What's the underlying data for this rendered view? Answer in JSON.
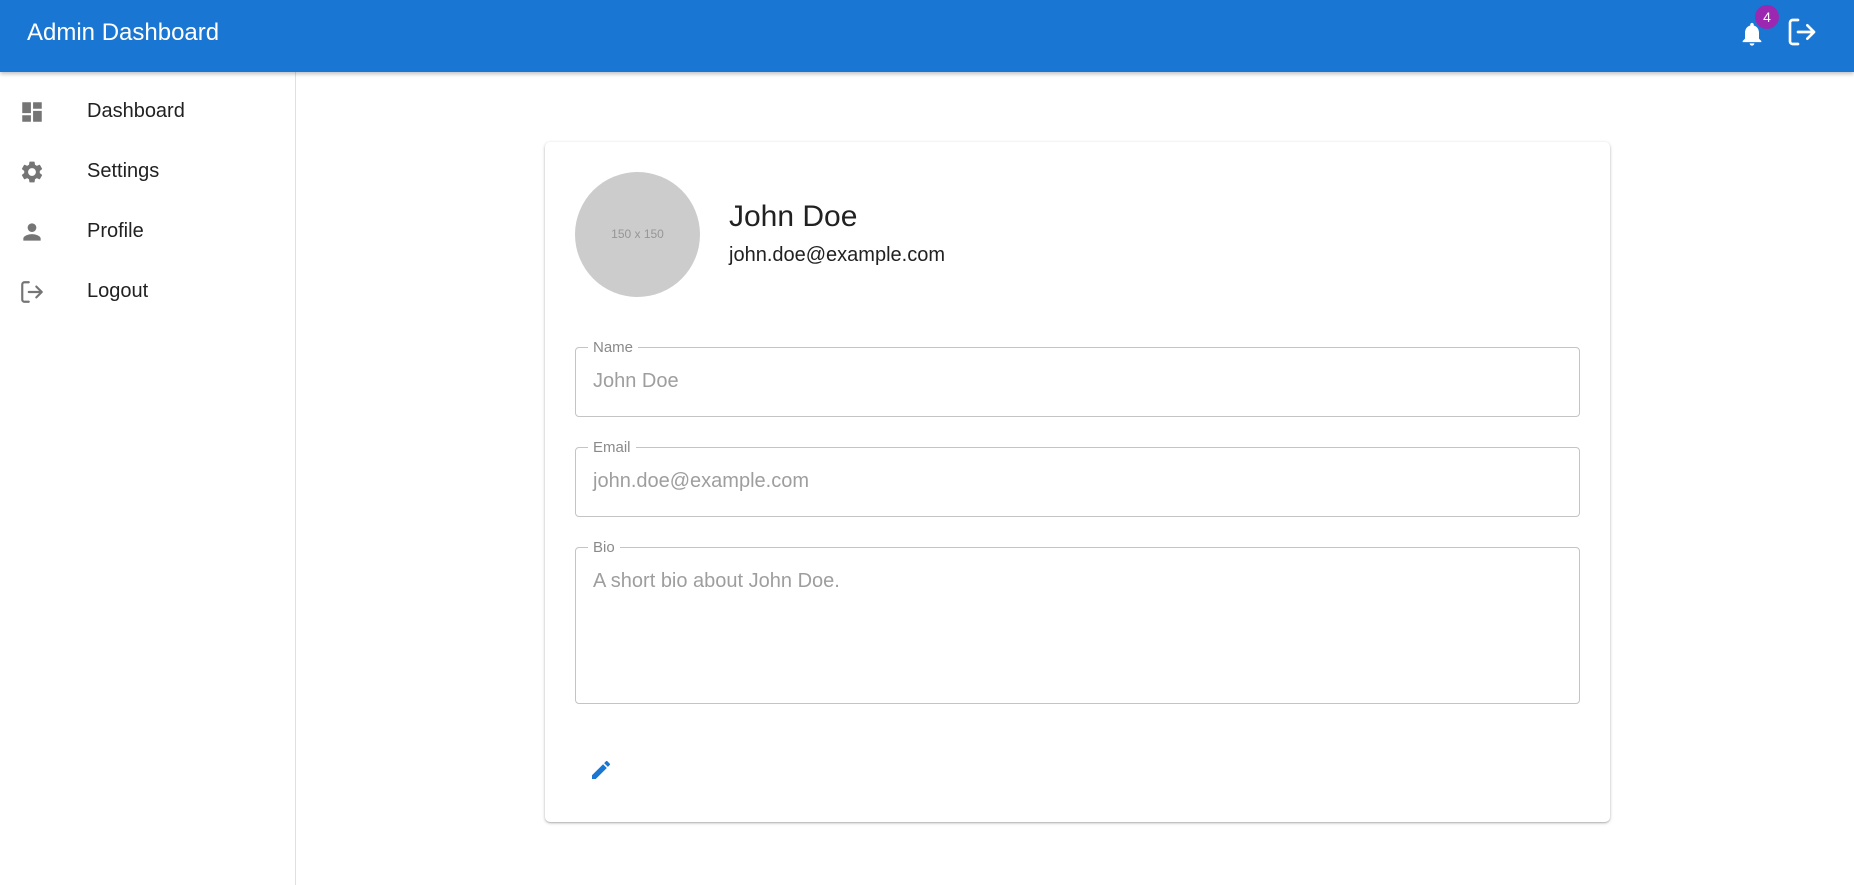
{
  "app": {
    "title": "Admin Dashboard",
    "notification_count": "4",
    "accent_color": "#1976d2",
    "badge_color": "#9c27b0",
    "icons": {
      "notifications": "bell-icon",
      "logout": "logout-icon"
    }
  },
  "sidebar": {
    "items": [
      {
        "label": "Dashboard",
        "icon": "dashboard-icon"
      },
      {
        "label": "Settings",
        "icon": "gear-icon"
      },
      {
        "label": "Profile",
        "icon": "person-icon"
      },
      {
        "label": "Logout",
        "icon": "logout-icon"
      }
    ]
  },
  "profile": {
    "avatar_placeholder": "150 x 150",
    "name": "John Doe",
    "email": "john.doe@example.com",
    "fields": {
      "name": {
        "label": "Name",
        "value": "John Doe"
      },
      "email": {
        "label": "Email",
        "value": "john.doe@example.com"
      },
      "bio": {
        "label": "Bio",
        "value": "A short bio about John Doe."
      }
    },
    "edit_icon": "pencil-icon"
  }
}
